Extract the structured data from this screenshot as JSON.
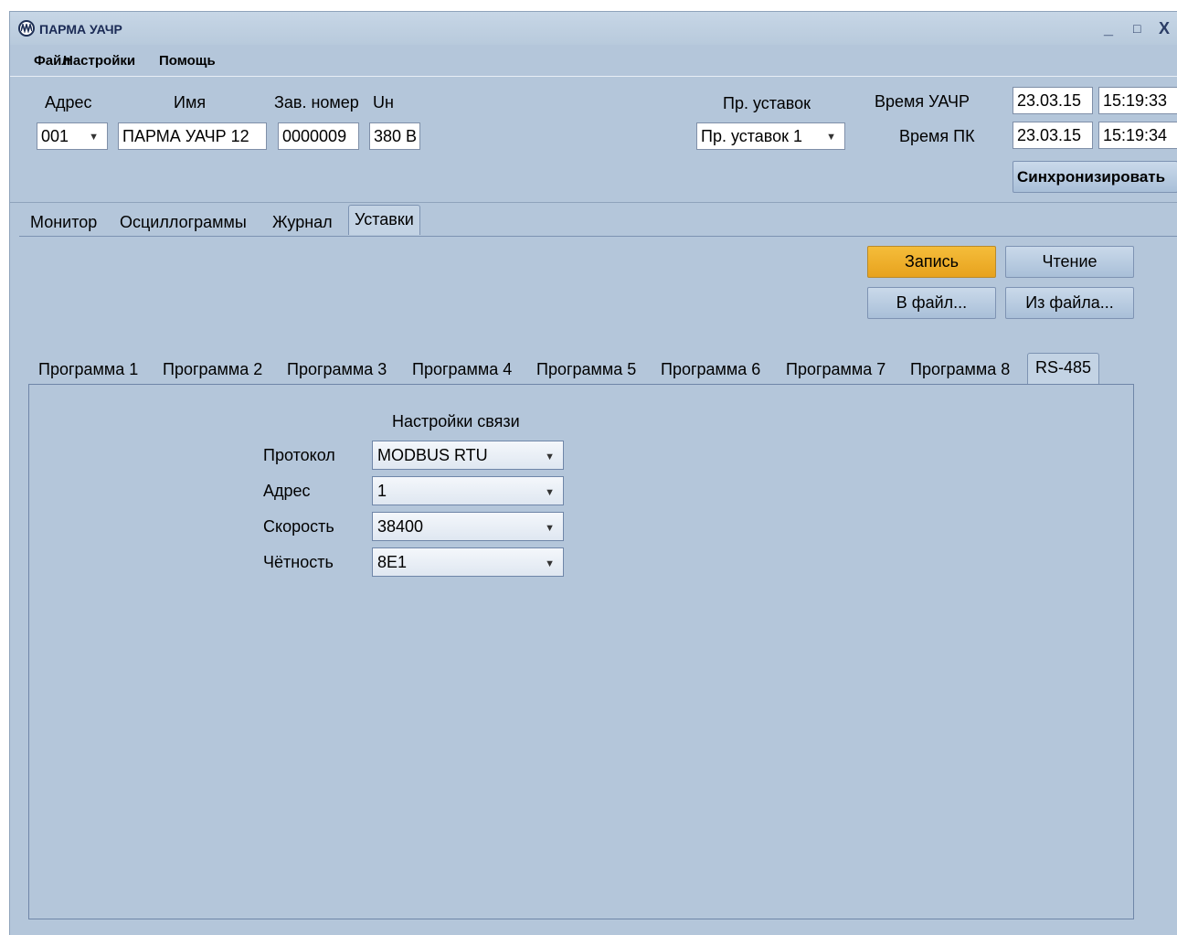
{
  "window": {
    "title": "ПАРМА УАЧР",
    "minimize": "_",
    "maximize": "□",
    "close": "X"
  },
  "menu": {
    "items": [
      "Файл",
      "Настройки",
      "Помощь"
    ]
  },
  "header": {
    "address_label": "Адрес",
    "name_label": "Имя",
    "serial_label": "Зав. номер",
    "un_label": "Uн",
    "address_value": "001",
    "name_value": "ПАРМА УАЧР 12",
    "serial_value": "0000009",
    "un_value": "380 В",
    "preset_label": "Пр. уставок",
    "preset_value": "Пр. уставок 1",
    "time_device_label": "Время УАЧР",
    "time_device_date": "23.03.15",
    "time_device_time": "15:19:33",
    "time_pc_label": "Время ПК",
    "time_pc_date": "23.03.15",
    "time_pc_time": "15:19:34",
    "sync_label": "Синхронизировать"
  },
  "main_tabs": [
    "Монитор",
    "Осциллограммы",
    "Журнал",
    "Уставки"
  ],
  "actions": {
    "write": "Запись",
    "read": "Чтение",
    "to_file": "В файл...",
    "from_file": "Из файла..."
  },
  "sub_tabs": [
    "Программа 1",
    "Программа 2",
    "Программа 3",
    "Программа 4",
    "Программа 5",
    "Программа 6",
    "Программа 7",
    "Программа 8",
    "RS-485"
  ],
  "comm": {
    "title": "Настройки связи",
    "protocol_label": "Протокол",
    "protocol_value": "MODBUS RTU",
    "address_label": "Адрес",
    "address_value": "1",
    "speed_label": "Скорость",
    "speed_value": "38400",
    "parity_label": "Чётность",
    "parity_value": "8E1"
  }
}
